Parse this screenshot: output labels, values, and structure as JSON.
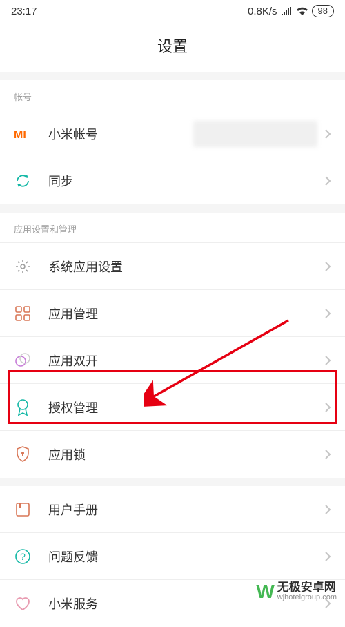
{
  "status": {
    "time": "23:17",
    "speed": "0.8K/s",
    "battery": "98"
  },
  "header": {
    "title": "设置"
  },
  "sections": [
    {
      "label": "帐号",
      "items": [
        {
          "id": "mi-account",
          "label": "小米帐号",
          "has_detail_blur": true
        },
        {
          "id": "sync",
          "label": "同步"
        }
      ]
    },
    {
      "label": "应用设置和管理",
      "items": [
        {
          "id": "system-apps",
          "label": "系统应用设置"
        },
        {
          "id": "app-manage",
          "label": "应用管理"
        },
        {
          "id": "dual-apps",
          "label": "应用双开"
        },
        {
          "id": "permissions",
          "label": "授权管理"
        },
        {
          "id": "app-lock",
          "label": "应用锁"
        }
      ]
    },
    {
      "label": "",
      "items": [
        {
          "id": "user-manual",
          "label": "用户手册"
        },
        {
          "id": "feedback",
          "label": "问题反馈"
        },
        {
          "id": "mi-service",
          "label": "小米服务"
        }
      ]
    }
  ],
  "watermark": {
    "logo": "W",
    "main": "无极安卓网",
    "sub": "wjhotelgroup.com"
  }
}
